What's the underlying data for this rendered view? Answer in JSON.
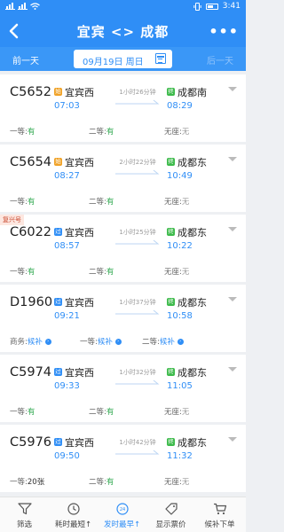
{
  "status": {
    "time": "3:41",
    "left_icons": [
      "wifi-icon",
      "signal-icon"
    ],
    "right_icons": [
      "vibrate-icon",
      "battery-icon"
    ]
  },
  "header": {
    "title": "宜宾 <> 成都",
    "back_icon": "chevron-left-icon",
    "more_icon": "more-icon"
  },
  "date_bar": {
    "prev": "前一天",
    "date": "09月19日 周日",
    "next": "后一天",
    "calendar_icon": "calendar-icon"
  },
  "colors": {
    "primary": "#2f8ef6",
    "available": "#2fa84f",
    "start_badge": "#f0a227",
    "pass_badge": "#2f8ef6",
    "end_badge": "#3cba4a"
  },
  "trains": [
    {
      "no": "C5652",
      "fuxing": "",
      "dep_badge": "始",
      "dep_type": "start",
      "dep_station": "宜宾西",
      "dep_time": "07:03",
      "duration": "1小时26分钟",
      "arr_badge": "终",
      "arr_station": "成都南",
      "arr_time": "08:29",
      "seats": [
        {
          "label": "一等:",
          "value": "有",
          "style": "green"
        },
        {
          "label": "二等:",
          "value": "有",
          "style": "green"
        },
        {
          "label": "无座:",
          "value": "无",
          "style": "grey"
        }
      ]
    },
    {
      "no": "C5654",
      "fuxing": "",
      "dep_badge": "始",
      "dep_type": "start",
      "dep_station": "宜宾西",
      "dep_time": "08:27",
      "duration": "2小时22分钟",
      "arr_badge": "终",
      "arr_station": "成都东",
      "arr_time": "10:49",
      "seats": [
        {
          "label": "一等:",
          "value": "有",
          "style": "green"
        },
        {
          "label": "二等:",
          "value": "有",
          "style": "green"
        },
        {
          "label": "无座:",
          "value": "无",
          "style": "grey"
        }
      ]
    },
    {
      "no": "C6022",
      "fuxing": "复兴号",
      "dep_badge": "过",
      "dep_type": "pass",
      "dep_station": "宜宾西",
      "dep_time": "08:57",
      "duration": "1小时25分钟",
      "arr_badge": "终",
      "arr_station": "成都东",
      "arr_time": "10:22",
      "seats": [
        {
          "label": "一等:",
          "value": "有",
          "style": "green"
        },
        {
          "label": "二等:",
          "value": "有",
          "style": "green"
        },
        {
          "label": "无座:",
          "value": "无",
          "style": "grey"
        }
      ]
    },
    {
      "no": "D1960",
      "fuxing": "",
      "dep_badge": "过",
      "dep_type": "pass",
      "dep_station": "宜宾西",
      "dep_time": "09:21",
      "duration": "1小时37分钟",
      "arr_badge": "终",
      "arr_station": "成都东",
      "arr_time": "10:58",
      "seats": [
        {
          "label": "商务:",
          "value": "候补",
          "style": "blue"
        },
        {
          "label": "一等:",
          "value": "候补",
          "style": "blue"
        },
        {
          "label": "二等:",
          "value": "候补",
          "style": "blue"
        }
      ]
    },
    {
      "no": "C5974",
      "fuxing": "",
      "dep_badge": "过",
      "dep_type": "pass",
      "dep_station": "宜宾西",
      "dep_time": "09:33",
      "duration": "1小时32分钟",
      "arr_badge": "终",
      "arr_station": "成都东",
      "arr_time": "11:05",
      "seats": [
        {
          "label": "一等:",
          "value": "有",
          "style": "green"
        },
        {
          "label": "二等:",
          "value": "有",
          "style": "green"
        },
        {
          "label": "无座:",
          "value": "无",
          "style": "grey"
        }
      ]
    },
    {
      "no": "C5976",
      "fuxing": "",
      "dep_badge": "过",
      "dep_type": "pass",
      "dep_station": "宜宾西",
      "dep_time": "09:50",
      "duration": "1小时42分钟",
      "arr_badge": "终",
      "arr_station": "成都东",
      "arr_time": "11:32",
      "seats": [
        {
          "label": "一等:",
          "value": "20张",
          "style": "dark"
        },
        {
          "label": "二等:",
          "value": "有",
          "style": "green"
        },
        {
          "label": "无座:",
          "value": "无",
          "style": "grey"
        }
      ]
    }
  ],
  "bottom_tabs": [
    {
      "label": "筛选",
      "icon": "filter-icon",
      "active": false
    },
    {
      "label": "耗时最短↑",
      "icon": "clock-icon",
      "active": false
    },
    {
      "label": "发时最早↑",
      "icon": "departure-time-icon",
      "active": true
    },
    {
      "label": "显示票价",
      "icon": "price-tag-icon",
      "active": false
    },
    {
      "label": "候补下单",
      "icon": "cart-icon",
      "active": false
    }
  ]
}
